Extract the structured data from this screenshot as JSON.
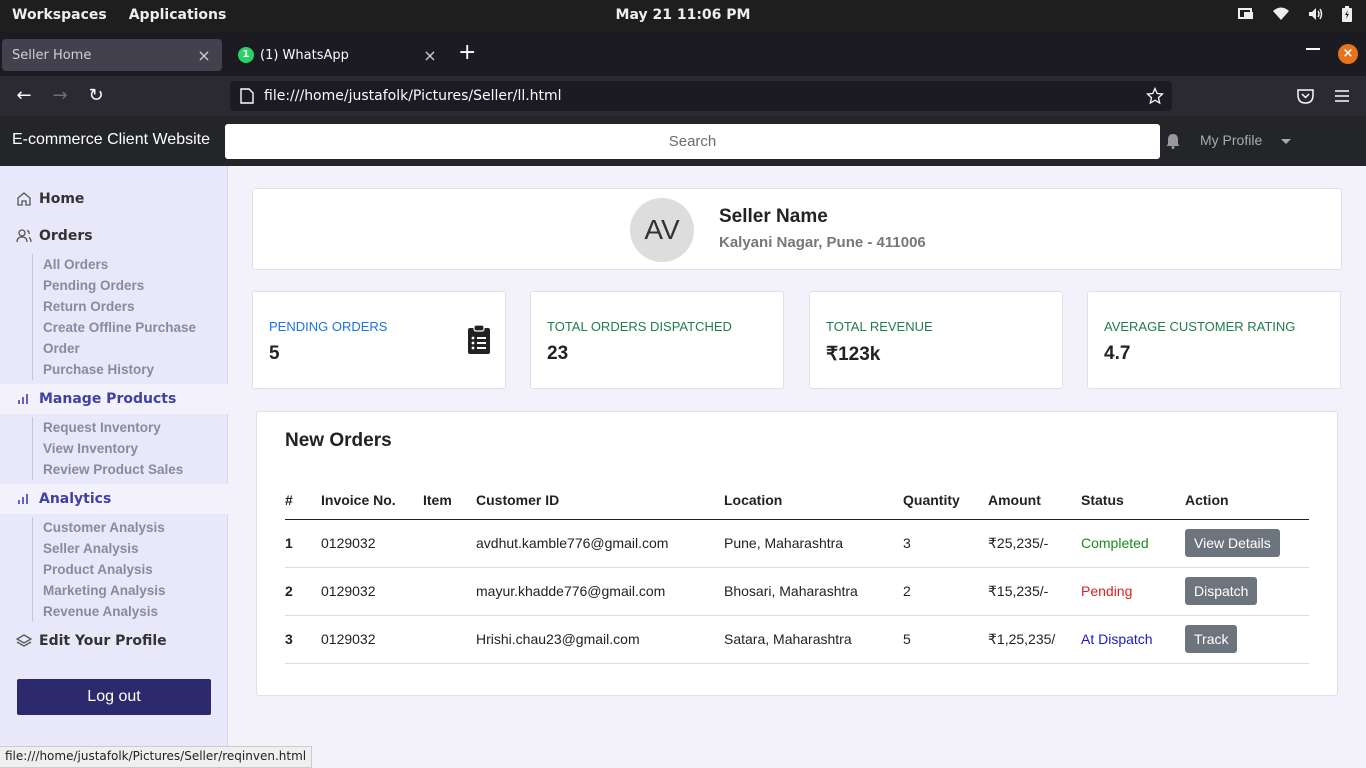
{
  "system": {
    "menu_workspaces": "Workspaces",
    "menu_applications": "Applications",
    "clock": "May 21  11:06 PM"
  },
  "browser": {
    "tabs": [
      {
        "title": "Seller Home",
        "active": false
      },
      {
        "title": "(1) WhatsApp",
        "active": true,
        "badge": "1"
      }
    ],
    "url": "file:///home/justafolk/Pictures/Seller/ll.html",
    "status_url": "file:///home/justafolk/Pictures/Seller/reqinven.html"
  },
  "header": {
    "brand": "E-commerce Client Website",
    "search_placeholder": "Search",
    "profile_label": "My Profile"
  },
  "sidebar": {
    "home": "Home",
    "orders": {
      "label": "Orders",
      "items": [
        "All Orders",
        "Pending Orders",
        "Return Orders",
        "Create Offline Purchase",
        "Order",
        "Purchase History"
      ]
    },
    "manage_products": {
      "label": "Manage Products",
      "items": [
        "Request Inventory",
        "View Inventory",
        "Review Product Sales"
      ]
    },
    "analytics": {
      "label": "Analytics",
      "items": [
        "Customer Analysis",
        "Seller Analysis",
        "Product Analysis",
        "Marketing Analysis",
        "Revenue Analysis"
      ]
    },
    "edit_profile": "Edit Your Profile",
    "logout": "Log out"
  },
  "seller": {
    "initials": "AV",
    "name": "Seller Name",
    "address": "Kalyani Nagar, Pune - 411006"
  },
  "stats": [
    {
      "label": "PENDING ORDERS",
      "value": "5",
      "color": "#1a73e8"
    },
    {
      "label": "TOTAL ORDERS DISPATCHED",
      "value": "23",
      "color": "#1e7e4e"
    },
    {
      "label": "TOTAL REVENUE",
      "value": "₹123k",
      "color": "#1e7e4e"
    },
    {
      "label": "AVERAGE CUSTOMER RATING",
      "value": "4.7",
      "color": "#1e7e4e"
    }
  ],
  "orders": {
    "title": "New Orders",
    "columns": [
      "#",
      "Invoice No.",
      "Item",
      "Customer ID",
      "Location",
      "Quantity",
      "Amount",
      "Status",
      "Action"
    ],
    "rows": [
      {
        "num": "1",
        "invoice": "0129032",
        "item": "",
        "customer": "avdhut.kamble776@gmail.com",
        "location": "Pune, Maharashtra",
        "qty": "3",
        "amount": "₹25,235/-",
        "status": "Completed",
        "status_color": "#1b8a1b",
        "action": "View Details"
      },
      {
        "num": "2",
        "invoice": "0129032",
        "item": "",
        "customer": "mayur.khadde776@gmail.com",
        "location": "Bhosari, Maharashtra",
        "qty": "2",
        "amount": "₹15,235/-",
        "status": "Pending",
        "status_color": "#e02020",
        "action": "Dispatch"
      },
      {
        "num": "3",
        "invoice": "0129032",
        "item": "",
        "customer": "Hrishi.chau23@gmail.com",
        "location": "Satara, Maharashtra",
        "qty": "5",
        "amount": "₹1,25,235/",
        "status": "At Dispatch",
        "status_color": "#1a1ad0",
        "action": "Track"
      }
    ]
  }
}
